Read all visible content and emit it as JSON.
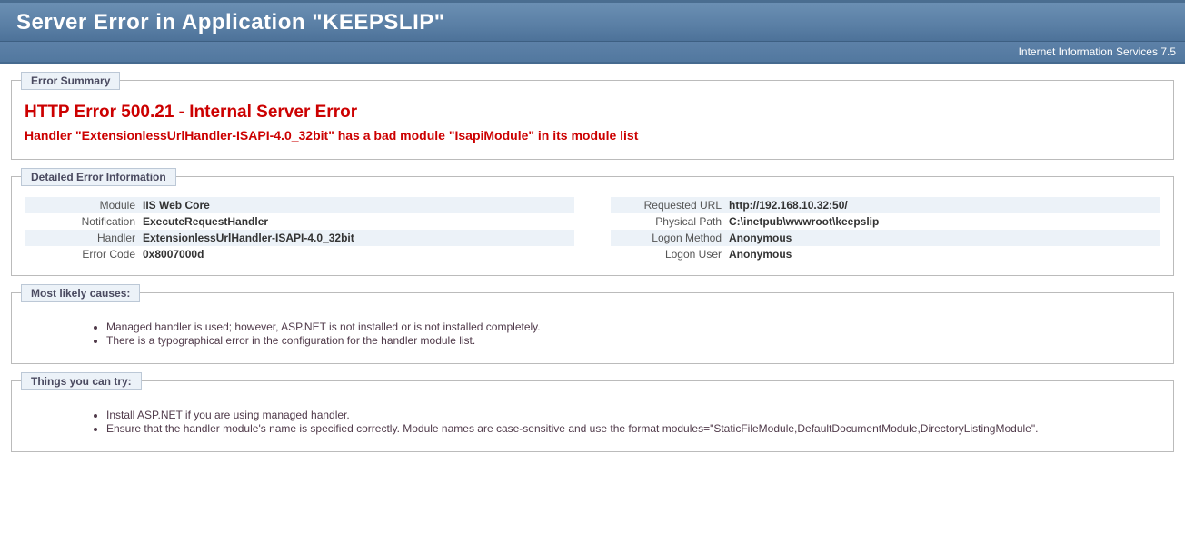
{
  "header": {
    "title": "Server Error in Application \"KEEPSLIP\"",
    "subtitle": "Internet Information Services 7.5"
  },
  "summary": {
    "legend": "Error Summary",
    "title": "HTTP Error 500.21 - Internal Server Error",
    "subtitle": "Handler \"ExtensionlessUrlHandler-ISAPI-4.0_32bit\" has a bad module \"IsapiModule\" in its module list"
  },
  "details": {
    "legend": "Detailed Error Information",
    "left": [
      {
        "label": "Module",
        "value": "IIS Web Core"
      },
      {
        "label": "Notification",
        "value": "ExecuteRequestHandler"
      },
      {
        "label": "Handler",
        "value": "ExtensionlessUrlHandler-ISAPI-4.0_32bit"
      },
      {
        "label": "Error Code",
        "value": "0x8007000d"
      }
    ],
    "right": [
      {
        "label": "Requested URL",
        "value": "http://192.168.10.32:50/"
      },
      {
        "label": "Physical Path",
        "value": "C:\\inetpub\\wwwroot\\keepslip"
      },
      {
        "label": "Logon Method",
        "value": "Anonymous"
      },
      {
        "label": "Logon User",
        "value": "Anonymous"
      }
    ]
  },
  "causes": {
    "legend": "Most likely causes:",
    "items": [
      "Managed handler is used; however, ASP.NET is not installed or is not installed completely.",
      "There is a typographical error in the configuration for the handler module list."
    ]
  },
  "tryThings": {
    "legend": "Things you can try:",
    "items": [
      "Install ASP.NET if you are using managed handler.",
      "Ensure that the handler module's name is specified correctly. Module names are case-sensitive and use the format modules=\"StaticFileModule,DefaultDocumentModule,DirectoryListingModule\"."
    ]
  }
}
